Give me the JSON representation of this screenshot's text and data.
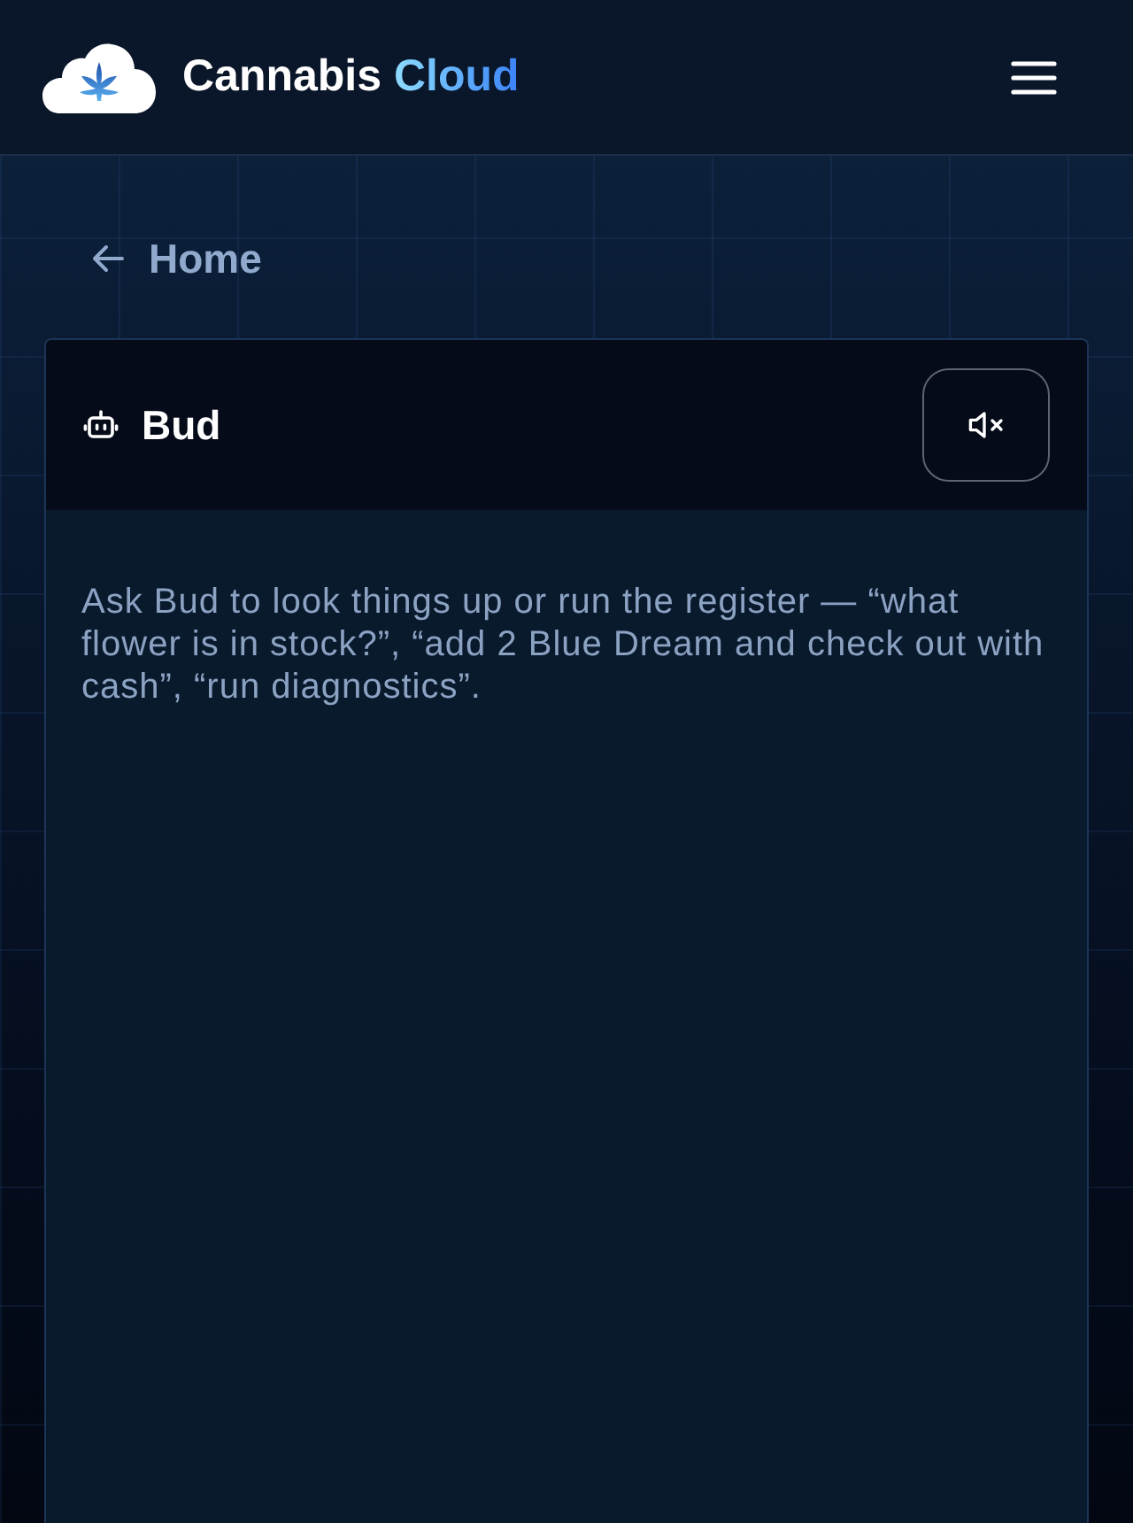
{
  "header": {
    "brand": {
      "name": "Cannabis",
      "highlight": "Cloud"
    }
  },
  "breadcrumb": {
    "back_label": "Home"
  },
  "assistant_panel": {
    "title": "Bud",
    "muted": true,
    "intro": "Ask Bud to look things up or run the register — “what flower is in stock?”, “add 2 Blue Dream and check out with cash”, “run diagnostics”."
  }
}
